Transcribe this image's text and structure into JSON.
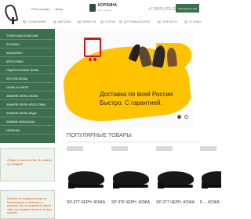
{
  "header": {
    "links": [
      "Регистрация",
      "Вход"
    ],
    "cart_title": "КОРЗИНА",
    "cart_subtitle": "Нет товаров",
    "phone": "+7 (926) 676-3231",
    "callback_label": "Перезвоните мне"
  },
  "nav": [
    "О КОМПАНИИ",
    "МАГАЗИН",
    "НОВОСТИ",
    "СТАТЬИ",
    "ДОСТАВКА/ОПЛАТА",
    "КОНТАКТЫ",
    "ОТЗЫВЫ"
  ],
  "sidebar": [
    "ТУФЛИ КЛАССИЧЕСКИЕ",
    "БОТИНКИ",
    "МОКАСИНЫ",
    "КРОССОВКИ",
    "ПОДРОСТКОВАЯ ОБУВЬ",
    "ЛЕТНЯЯ ОБУВЬ",
    "ОБУВЬ НА МЕХЕ",
    "ЗИМНЯЯ ОБУВЬ ОБУВЬ",
    "ЗИМНЯЯ ОБУВЬ КРОССОВКА",
    "ЗИМНЯЯ ОБУВЬ КЕДЫ",
    "ЗИМНИЕ МОКАСИНЫ",
    "НОВИНКИ"
  ],
  "banner": {
    "text": "Доставка по всей России\nБыстро. С гарантией."
  },
  "products": {
    "title": "ПОПУЛЯРНЫЕ ТОВАРЫ",
    "items": [
      {
        "name": "SP-377 ЧЕРН. КОЖА"
      },
      {
        "name": "SP-376 ЧЕРН. КОЖА"
      },
      {
        "name": "SP-377 ЧЕРН. КОЖА"
      },
      {
        "name": "F-... КОЖА"
      }
    ]
  },
  "promos": [
    "Обувь только оптом. В размер ну продам!",
    "Прошёл по поводу розницы не беспокоиться, а заменить в размеру. Мы не продаём по одной паре, мы продаём оптом от 6 пар в коробке."
  ],
  "colors": {
    "brand_green": "#3d6f4f",
    "map_yellow": "#ffc300",
    "accent_orange": "#e35b00"
  },
  "icons": {
    "logo": "shoe-logo",
    "cart": "cart-icon"
  }
}
